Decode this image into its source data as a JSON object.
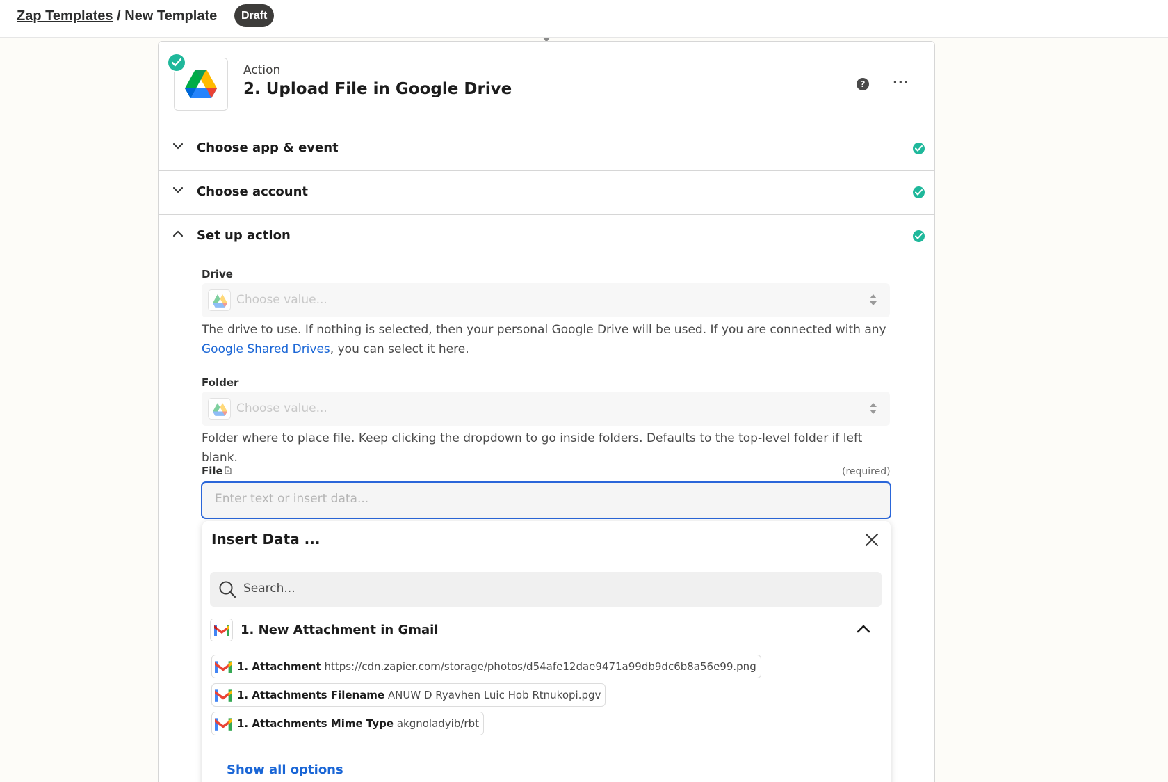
{
  "breadcrumb": {
    "parent": "Zap Templates",
    "separator": " / ",
    "current": "New Template"
  },
  "status_badge": "Draft",
  "step": {
    "kicker": "Action",
    "title": "2. Upload File in Google Drive",
    "help_icon": "question-circle-icon",
    "more_icon": "ellipsis-icon",
    "more_label": "···"
  },
  "sections": [
    {
      "label": "Choose app & event",
      "expanded": false,
      "complete": true
    },
    {
      "label": "Choose account",
      "expanded": false,
      "complete": true
    },
    {
      "label": "Set up action",
      "expanded": true,
      "complete": true
    }
  ],
  "fields": {
    "drive": {
      "label": "Drive",
      "placeholder": "Choose value...",
      "help_prefix": "The drive to use. If nothing is selected, then your personal Google Drive will be used. If you are connected with any ",
      "help_link": "Google Shared Drives",
      "help_suffix": ", you can select it here."
    },
    "folder": {
      "label": "Folder",
      "placeholder": "Choose value...",
      "help": "Folder where to place file. Keep clicking the dropdown to go inside folders. Defaults to the top-level folder if left blank."
    },
    "file": {
      "label": "File",
      "required": "(required)",
      "placeholder": "Enter text or insert data...",
      "value": ""
    }
  },
  "insert_data": {
    "title": "Insert Data ...",
    "search_placeholder": "Search...",
    "group_title": "1. New Attachment in Gmail",
    "items": [
      {
        "key": "1. Attachment",
        "value": "https://cdn.zapier.com/storage/photos/d54afe12dae9471a99db9dc6b8a56e99.png"
      },
      {
        "key": "1. Attachments Filename",
        "value": "ANUW D Ryavhen Luic Hob Rtnukopi.pgv"
      },
      {
        "key": "1. Attachments Mime Type",
        "value": "akgnoladyib/rbt"
      }
    ],
    "show_all": "Show all options"
  },
  "colors": {
    "accent_blue": "#2a66d9",
    "link_blue": "#1a66d6",
    "success_green": "#1fb89b",
    "badge_dark": "#3d3c3a"
  }
}
